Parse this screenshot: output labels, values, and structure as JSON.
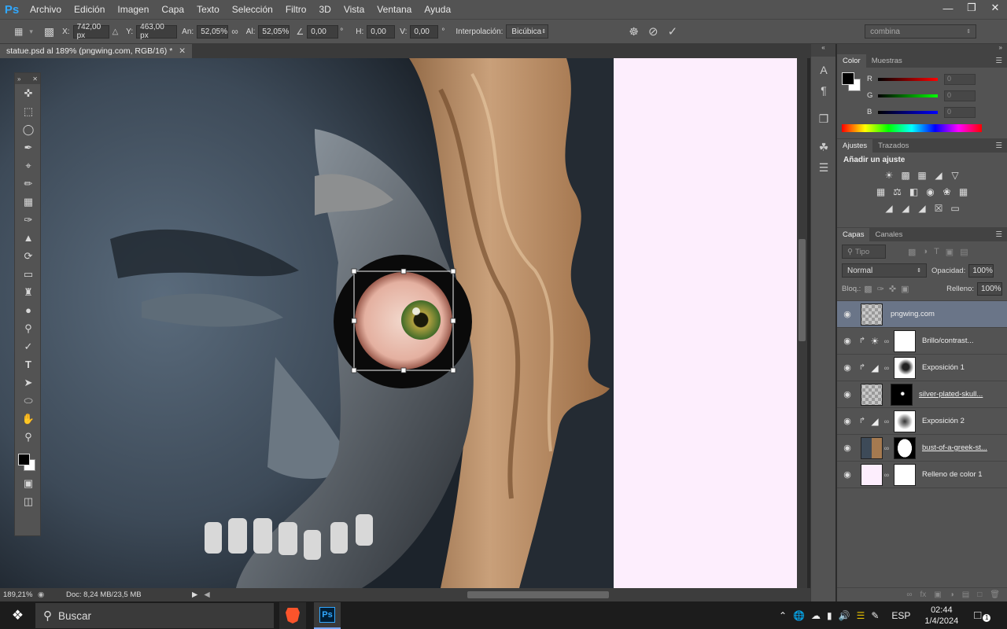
{
  "app": {
    "logo": "Ps",
    "menu": [
      "Archivo",
      "Edición",
      "Imagen",
      "Capa",
      "Texto",
      "Selección",
      "Filtro",
      "3D",
      "Vista",
      "Ventana",
      "Ayuda"
    ]
  },
  "options_bar": {
    "x_label": "X:",
    "x_value": "742,00 px",
    "y_label": "Y:",
    "y_value": "463,00 px",
    "w_label": "An:",
    "w_value": "52,05%",
    "h_label": "Al:",
    "h_value": "52,05%",
    "angle_value": "0,00",
    "angle_unit": "°",
    "hskew_label": "H:",
    "hskew_value": "0,00",
    "vskew_label": "V:",
    "vskew_value": "0,00",
    "interp_label": "Interpolación:",
    "interp_value": "Bicúbica",
    "workspace": "combina"
  },
  "document": {
    "tab_title": "statue.psd al 189% (pngwing.com, RGB/16) *",
    "zoom": "189,21%",
    "doc_size": "Doc: 8,24 MB/23,5 MB"
  },
  "color_panel": {
    "tabs": [
      "Color",
      "Muestras"
    ],
    "channels": [
      {
        "label": "R",
        "value": "0"
      },
      {
        "label": "G",
        "value": "0"
      },
      {
        "label": "B",
        "value": "0"
      }
    ]
  },
  "adjustments_panel": {
    "tabs": [
      "Ajustes",
      "Trazados"
    ],
    "title": "Añadir un ajuste"
  },
  "layers_panel": {
    "tabs": [
      "Capas",
      "Canales"
    ],
    "filter": "Tipo",
    "blend_mode": "Normal",
    "opacity_label": "Opacidad:",
    "opacity": "100%",
    "lock_label": "Bloq.:",
    "fill_label": "Relleno:",
    "fill": "100%",
    "layers": [
      {
        "name": "pngwing.com",
        "selected": true
      },
      {
        "name": "Brillo/contrast..."
      },
      {
        "name": "Exposición 1"
      },
      {
        "name": "silver-plated-skull..."
      },
      {
        "name": "Exposición 2"
      },
      {
        "name": "bust-of-a-greek-st..."
      },
      {
        "name": "Relleno de color 1"
      }
    ]
  },
  "taskbar": {
    "search_placeholder": "Buscar",
    "language": "ESP",
    "time": "02:44",
    "date": "1/4/2024",
    "notifications": "1"
  }
}
